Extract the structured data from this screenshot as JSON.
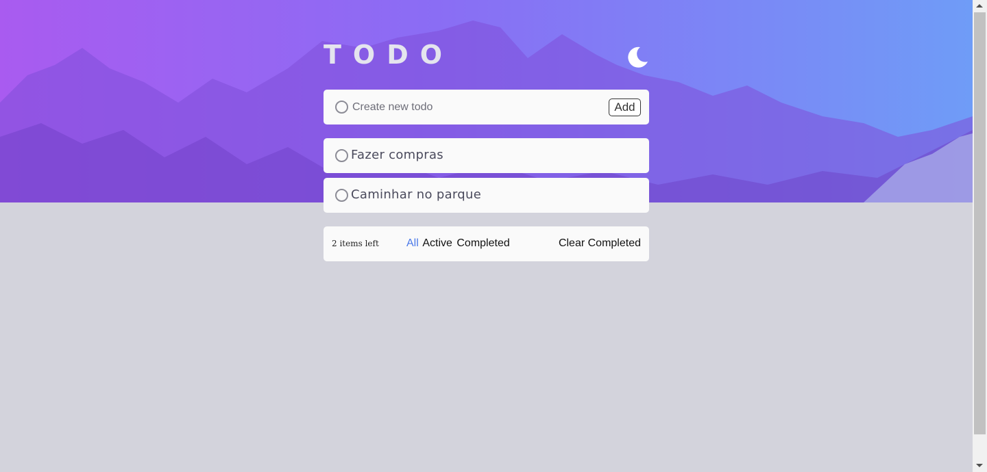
{
  "app": {
    "title": "TODO",
    "theme_icon": "moon-icon"
  },
  "new_todo": {
    "placeholder": "Create new todo",
    "add_label": "Add",
    "circle_icon": "circle-icon"
  },
  "todos": [
    {
      "label": "Fazer compras",
      "completed": false
    },
    {
      "label": "Caminhar no parque",
      "completed": false
    }
  ],
  "footer": {
    "items_left": "2 items left",
    "filters": [
      {
        "label": "All",
        "active": true
      },
      {
        "label": "Active",
        "active": false
      },
      {
        "label": "Completed",
        "active": false
      }
    ],
    "clear_label": "Clear Completed"
  },
  "colors": {
    "accent": "#4a78e8",
    "background": "#d3d3dc",
    "card": "#fafafa",
    "hero_start": "#a95bf0",
    "hero_end": "#6f9cf7"
  }
}
